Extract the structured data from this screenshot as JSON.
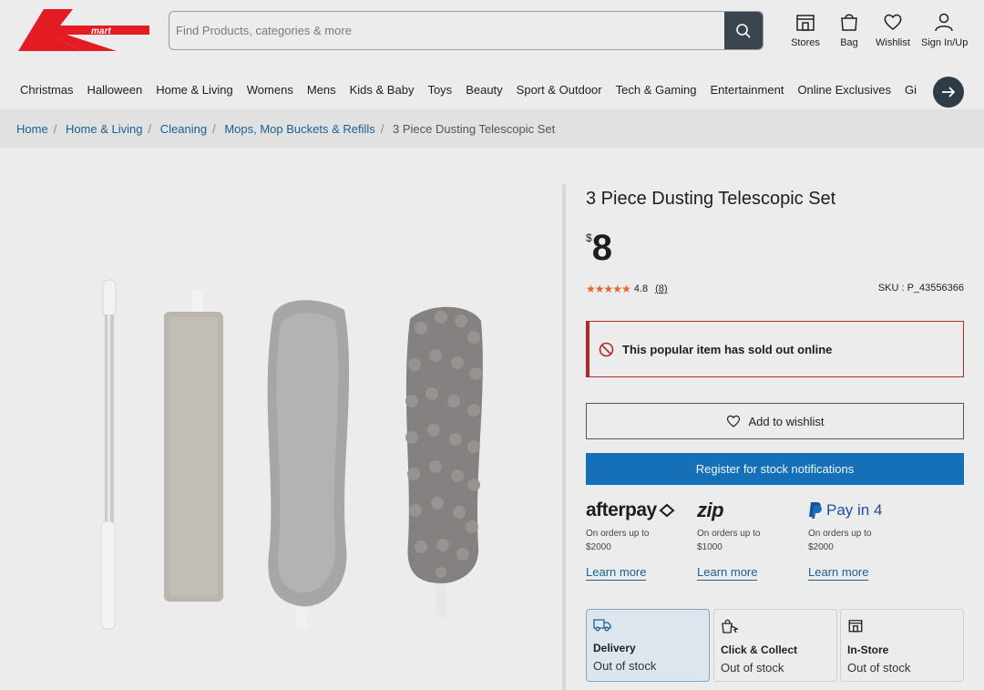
{
  "header": {
    "logo_text": "Kmart",
    "search_placeholder": "Find Products, categories & more",
    "icons": [
      {
        "icon": "store-icon",
        "label": "Stores"
      },
      {
        "icon": "bag-icon",
        "label": "Bag"
      },
      {
        "icon": "heart-icon",
        "label": "Wishlist"
      },
      {
        "icon": "user-icon",
        "label": "Sign In/Up"
      }
    ]
  },
  "nav": {
    "items": [
      "Christmas",
      "Halloween",
      "Home & Living",
      "Womens",
      "Mens",
      "Kids & Baby",
      "Toys",
      "Beauty",
      "Sport & Outdoor",
      "Tech & Gaming",
      "Entertainment",
      "Online Exclusives",
      "Gi"
    ]
  },
  "breadcrumb": {
    "links": [
      "Home",
      "Home & Living",
      "Cleaning",
      "Mops, Mop Buckets & Refills"
    ],
    "current": "3 Piece Dusting Telescopic Set"
  },
  "product": {
    "title": "3 Piece Dusting Telescopic Set",
    "currency": "$",
    "price": "8",
    "rating": "4.8",
    "rating_value": 4.8,
    "review_count": "(8)",
    "sku": "SKU : P_43556366",
    "soldout_message": "This popular item has sold out online",
    "wishlist_label": "Add to wishlist",
    "notify_label": "Register for stock notifications"
  },
  "payments": [
    {
      "brand": "afterpay",
      "desc_line1": "On orders up to",
      "desc_line2": "$2000",
      "learn": "Learn more"
    },
    {
      "brand": "zip",
      "desc_line1": "On orders up to",
      "desc_line2": "$1000",
      "learn": "Learn more"
    },
    {
      "brand": "Pay in 4",
      "desc_line1": "On orders up to",
      "desc_line2": "$2000",
      "learn": "Learn more"
    }
  ],
  "fulfilment": [
    {
      "icon": "truck-icon",
      "name": "Delivery",
      "status": "Out of stock"
    },
    {
      "icon": "click-collect-icon",
      "name": "Click & Collect",
      "status": "Out of stock"
    },
    {
      "icon": "store-icon",
      "name": "In-Store",
      "status": "Out of stock"
    }
  ],
  "colors": {
    "brand_red": "#e31b23",
    "primary_blue": "#1670b8",
    "link_blue": "#1b5f8f",
    "alert_red": "#b02a2a",
    "star_orange": "#e2672a"
  }
}
